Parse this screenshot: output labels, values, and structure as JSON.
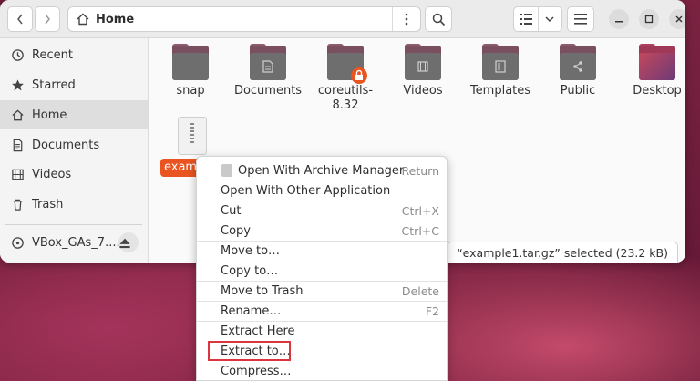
{
  "location": {
    "path": "Home"
  },
  "sidebar": {
    "items": [
      {
        "label": "Recent",
        "icon": "clock-icon"
      },
      {
        "label": "Starred",
        "icon": "star-icon"
      },
      {
        "label": "Home",
        "icon": "home-icon"
      },
      {
        "label": "Documents",
        "icon": "document-icon"
      },
      {
        "label": "Videos",
        "icon": "video-icon"
      },
      {
        "label": "Trash",
        "icon": "trash-icon"
      }
    ],
    "device": {
      "label": "VBox_GAs_7....",
      "icon": "disc-icon"
    }
  },
  "files": [
    {
      "name": "snap"
    },
    {
      "name": "Documents"
    },
    {
      "name": "coreutils-8.32",
      "line1": "coreutils-",
      "line2": "8.32"
    },
    {
      "name": "Videos"
    },
    {
      "name": "Templates"
    },
    {
      "name": "Public"
    },
    {
      "name": "Desktop"
    },
    {
      "name": "example1.tar.gz",
      "visible_label": "example1.tar.gz"
    }
  ],
  "status": {
    "text": "“example1.tar.gz” selected  (23.2 kB)"
  },
  "context_menu": {
    "items": [
      {
        "label": "Open With Archive Manager",
        "accel": "Return"
      },
      {
        "label": "Open With Other Application",
        "accel": ""
      },
      {
        "label": "Cut",
        "accel": "Ctrl+X"
      },
      {
        "label": "Copy",
        "accel": "Ctrl+C"
      },
      {
        "label": "Move to…",
        "accel": ""
      },
      {
        "label": "Copy to…",
        "accel": ""
      },
      {
        "label": "Move to Trash",
        "accel": "Delete"
      },
      {
        "label": "Rename…",
        "accel": "F2"
      },
      {
        "label": "Extract Here",
        "accel": ""
      },
      {
        "label": "Extract to…",
        "accel": ""
      },
      {
        "label": "Compress…",
        "accel": ""
      }
    ]
  },
  "colors": {
    "accent": "#e95420",
    "highlight_box": "#d9363e"
  }
}
